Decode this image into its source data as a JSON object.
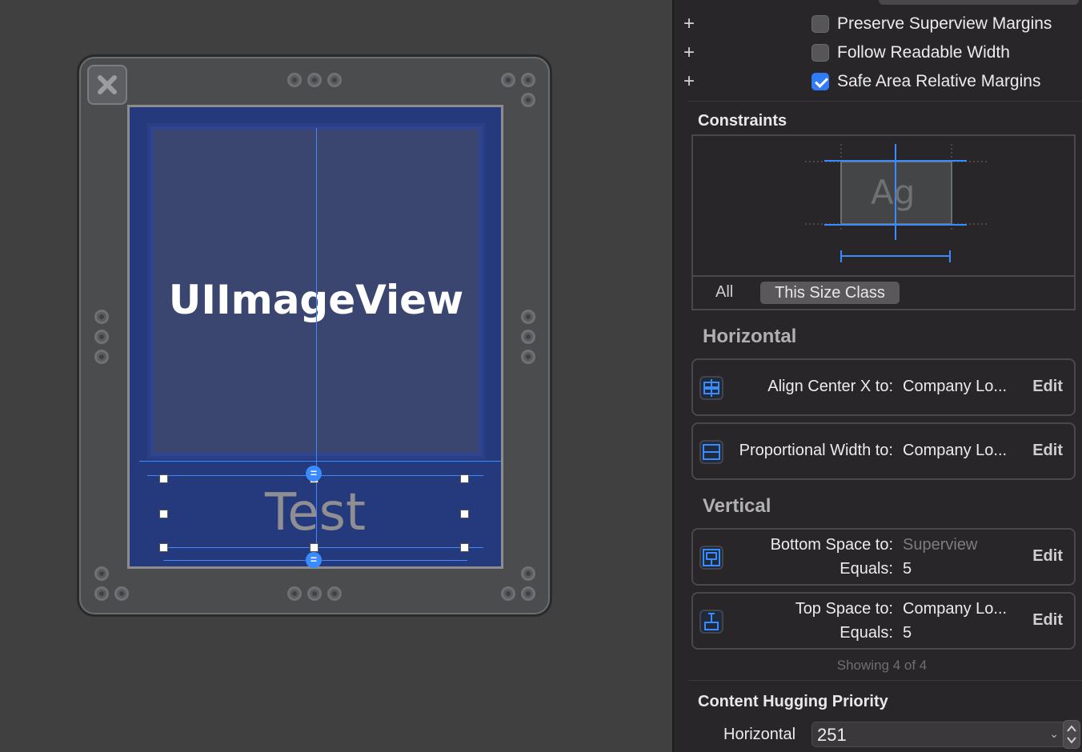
{
  "canvas": {
    "image_view_label": "UIImageView",
    "label_view_text": "Test"
  },
  "inspector": {
    "checkboxes": [
      {
        "label": "Preserve Superview Margins",
        "checked": false
      },
      {
        "label": "Follow Readable Width",
        "checked": false
      },
      {
        "label": "Safe Area Relative Margins",
        "checked": true
      }
    ],
    "constraints_title": "Constraints",
    "preview_text": "Ag",
    "size_class": {
      "all": "All",
      "this": "This Size Class"
    },
    "horizontal_title": "Horizontal",
    "vertical_title": "Vertical",
    "constraints": [
      {
        "label": "Align Center X to:",
        "target": "Company Lo...",
        "edit": "Edit"
      },
      {
        "label": "Proportional Width to:",
        "target": "Company Lo...",
        "edit": "Edit"
      },
      {
        "label": "Bottom Space to:",
        "target": "Superview",
        "equals_label": "Equals:",
        "equals": "5",
        "edit": "Edit"
      },
      {
        "label": "Top Space to:",
        "target": "Company Lo...",
        "equals_label": "Equals:",
        "equals": "5",
        "edit": "Edit"
      }
    ],
    "showing": "Showing 4 of 4",
    "hugging_title": "Content Hugging Priority",
    "hugging_horizontal_label": "Horizontal",
    "hugging_horizontal_value": "251",
    "colors": {
      "accent": "#3a8bff",
      "canvas_bg": "#404040",
      "inspector_bg": "#282629"
    }
  }
}
